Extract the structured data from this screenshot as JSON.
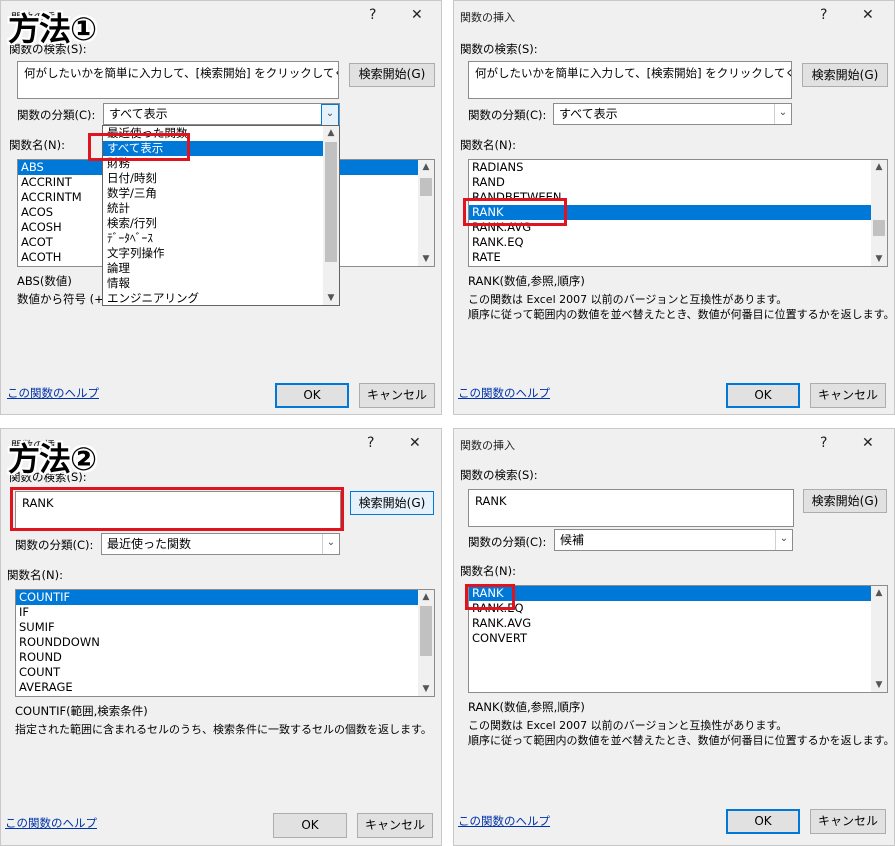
{
  "p1": {
    "badge": "方法①",
    "title": "関数の挿入",
    "question": "?",
    "close": "✕",
    "search_label": "関数の検索(S):",
    "search_value": "何がしたいかを簡単に入力して、[検索開始] をクリックしてください。",
    "search_button": "検索開始(G)",
    "category_label": "関数の分類(C):",
    "category_value": "すべて表示",
    "functions_label": "関数名(N):",
    "functions": [
      "ABS",
      "ACCRINT",
      "ACCRINTM",
      "ACOS",
      "ACOSH",
      "ACOT",
      "ACOTH"
    ],
    "dropdown_items": [
      "最近使った関数",
      "すべて表示",
      "財務",
      "日付/時刻",
      "数学/三角",
      "統計",
      "検索/行列",
      "ﾃﾞｰﾀﾍﾞｰｽ",
      "文字列操作",
      "論理",
      "情報",
      "エンジニアリング"
    ],
    "syntax": "ABS(数値)",
    "description": "数値から符号 (+",
    "help_link": "この関数のヘルプ",
    "ok": "OK",
    "cancel": "キャンセル"
  },
  "p2": {
    "title": "関数の挿入",
    "question": "?",
    "close": "✕",
    "search_label": "関数の検索(S):",
    "search_value": "何がしたいかを簡単に入力して、[検索開始] をクリックしてください。",
    "search_button": "検索開始(G)",
    "category_label": "関数の分類(C):",
    "category_value": "すべて表示",
    "functions_label": "関数名(N):",
    "functions": [
      "RADIANS",
      "RAND",
      "RANDBETWEEN",
      "RANK",
      "RANK.AVG",
      "RANK.EQ",
      "RATE"
    ],
    "syntax": "RANK(数値,参照,順序)",
    "desc1": "この関数は Excel 2007 以前のバージョンと互換性があります。",
    "desc2": "順序に従って範囲内の数値を並べ替えたとき、数値が何番目に位置するかを返します。",
    "help_link": "この関数のヘルプ",
    "ok": "OK",
    "cancel": "キャンセル"
  },
  "p3": {
    "badge": "方法②",
    "title": "関数の挿入",
    "question": "?",
    "close": "✕",
    "search_label": "関数の検索(S):",
    "search_value": "RANK",
    "search_button": "検索開始(G)",
    "category_label": "関数の分類(C):",
    "category_value": "最近使った関数",
    "functions_label": "関数名(N):",
    "functions": [
      "COUNTIF",
      "IF",
      "SUMIF",
      "ROUNDDOWN",
      "ROUND",
      "COUNT",
      "AVERAGE"
    ],
    "syntax": "COUNTIF(範囲,検索条件)",
    "desc1": "指定された範囲に含まれるセルのうち、検索条件に一致するセルの個数を返します。",
    "help_link": "この関数のヘルプ",
    "ok": "OK",
    "cancel": "キャンセル"
  },
  "p4": {
    "title": "関数の挿入",
    "question": "?",
    "close": "✕",
    "search_label": "関数の検索(S):",
    "search_value": "RANK",
    "search_button": "検索開始(G)",
    "category_label": "関数の分類(C):",
    "category_value": "候補",
    "functions_label": "関数名(N):",
    "functions": [
      "RANK",
      "RANK.EQ",
      "RANK.AVG",
      "CONVERT"
    ],
    "syntax": "RANK(数値,参照,順序)",
    "desc1": "この関数は Excel 2007 以前のバージョンと互換性があります。",
    "desc2": "順序に従って範囲内の数値を並べ替えたとき、数値が何番目に位置するかを返します。",
    "help_link": "この関数のヘルプ",
    "ok": "OK",
    "cancel": "キャンセル"
  },
  "colors": {
    "selection": "#0078d7",
    "highlight_box": "#e0141e",
    "link": "#0033aa"
  }
}
